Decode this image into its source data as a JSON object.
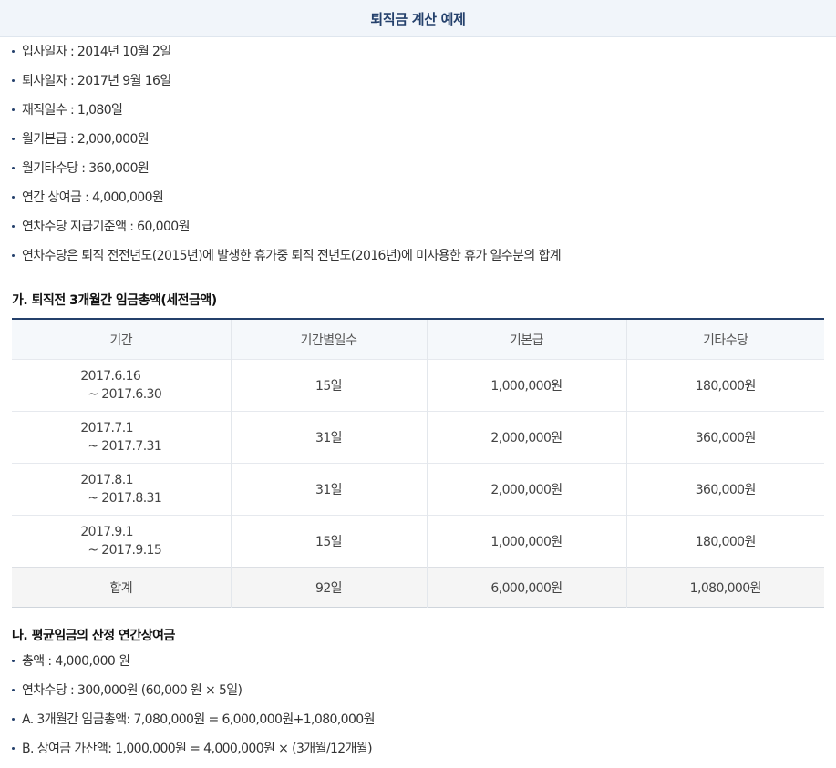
{
  "header": {
    "title": "퇴직금 계산 예제"
  },
  "info_items": [
    "입사일자 : 2014년 10월 2일",
    "퇴사일자 : 2017년 9월 16일",
    "재직일수 : 1,080일",
    "월기본급 : 2,000,000원",
    "월기타수당 : 360,000원",
    "연간 상여금 : 4,000,000원",
    "연차수당 지급기준액 : 60,000원",
    "연차수당은 퇴직 전전년도(2015년)에 발생한 휴가중 퇴직 전년도(2016년)에 미사용한 휴가 일수분의 합계"
  ],
  "section_a": {
    "title": "가. 퇴직전 3개월간 임금총액(세전금액)",
    "columns": [
      "기간",
      "기간별일수",
      "기본급",
      "기타수당"
    ],
    "rows": [
      {
        "period_start": "2017.6.16",
        "period_end": "~ 2017.6.30",
        "days": "15일",
        "base": "1,000,000원",
        "other": "180,000원"
      },
      {
        "period_start": "2017.7.1",
        "period_end": "~ 2017.7.31",
        "days": "31일",
        "base": "2,000,000원",
        "other": "360,000원"
      },
      {
        "period_start": "2017.8.1",
        "period_end": "~ 2017.8.31",
        "days": "31일",
        "base": "2,000,000원",
        "other": "360,000원"
      },
      {
        "period_start": "2017.9.1",
        "period_end": "~ 2017.9.15",
        "days": "15일",
        "base": "1,000,000원",
        "other": "180,000원"
      }
    ],
    "total": {
      "label": "합계",
      "days": "92일",
      "base": "6,000,000원",
      "other": "1,080,000원"
    }
  },
  "section_b": {
    "title": "나. 평균임금의 산정 연간상여금",
    "items": [
      "총액 : 4,000,000 원",
      "연차수당 : 300,000원 (60,000 원 × 5일)",
      "A. 3개월간 임금총액: 7,080,000원 = 6,000,000원+1,080,000원",
      "B. 상여금 가산액: 1,000,000원 = 4,000,000원 × (3개월/12개월)"
    ]
  }
}
